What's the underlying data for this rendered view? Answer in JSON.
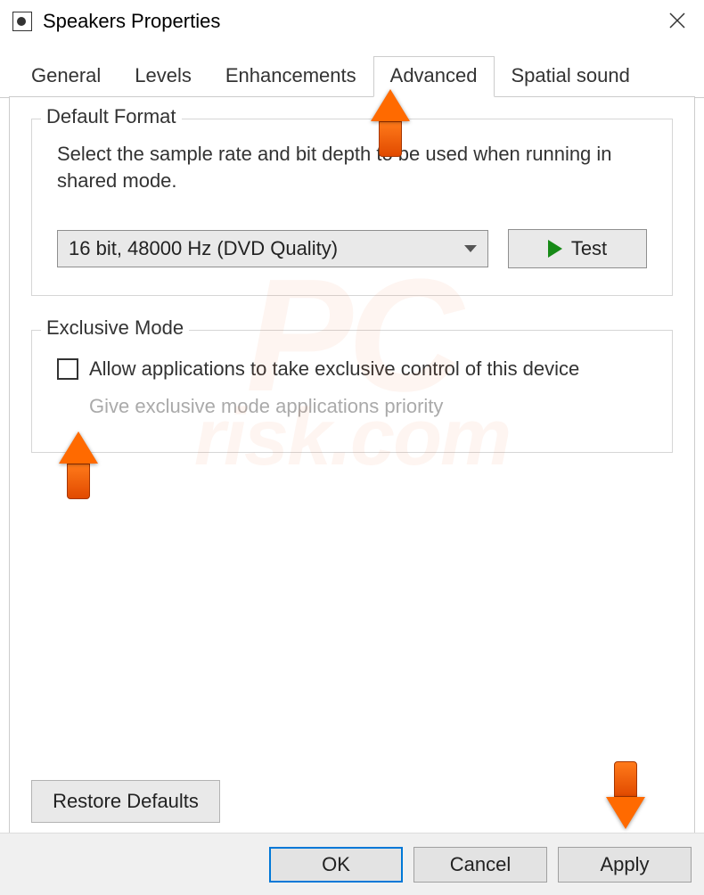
{
  "window": {
    "title": "Speakers Properties"
  },
  "tabs": {
    "general": "General",
    "levels": "Levels",
    "enhancements": "Enhancements",
    "advanced": "Advanced",
    "spatial": "Spatial sound"
  },
  "default_format": {
    "legend": "Default Format",
    "desc": "Select the sample rate and bit depth to be used when running in shared mode.",
    "selected": "16 bit, 48000 Hz (DVD Quality)",
    "test_label": "Test"
  },
  "exclusive_mode": {
    "legend": "Exclusive Mode",
    "allow_label": "Allow applications to take exclusive control of this device",
    "priority_label": "Give exclusive mode applications priority"
  },
  "restore_defaults_label": "Restore Defaults",
  "buttons": {
    "ok": "OK",
    "cancel": "Cancel",
    "apply": "Apply"
  },
  "watermark": {
    "line1": "PC",
    "line2": "risk.com"
  }
}
